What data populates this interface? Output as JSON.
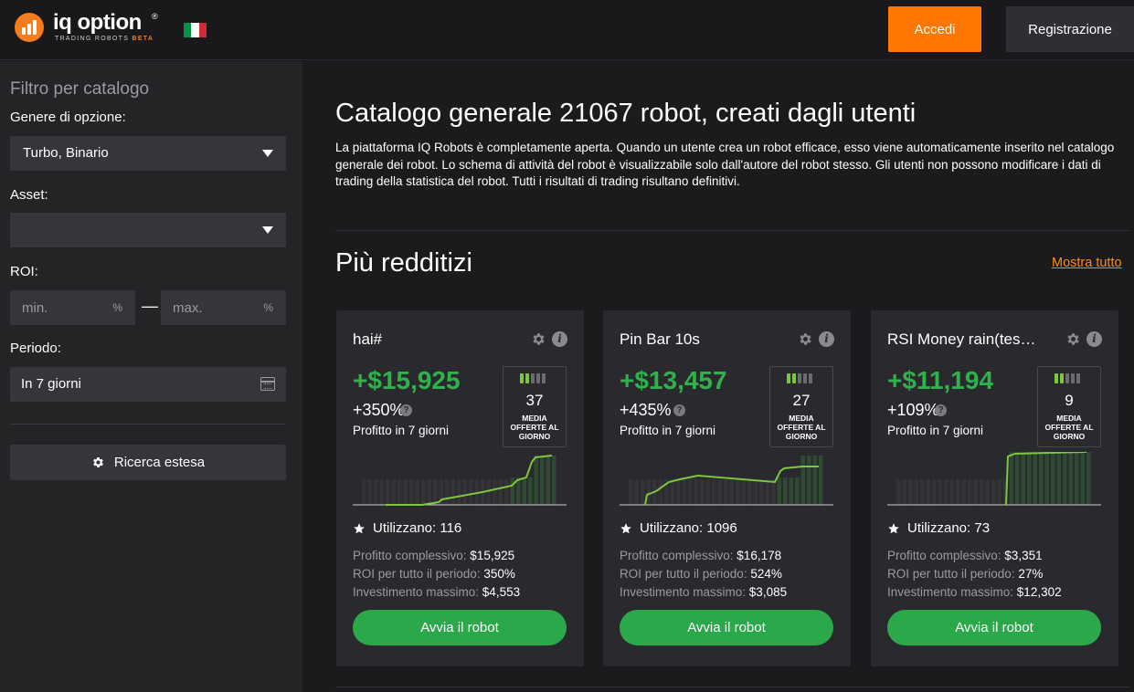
{
  "header": {
    "logo_name": "iq option",
    "logo_reg": "®",
    "logo_sub": "TRADING ROBOTS",
    "logo_beta": "BETA",
    "login_label": "Accedi",
    "register_label": "Registrazione",
    "flag_colors": [
      "#009246",
      "#ffffff",
      "#ce2b37"
    ]
  },
  "sidebar": {
    "title": "Filtro per catalogo",
    "option_type_label": "Genere di opzione:",
    "option_type_value": "Turbo, Binario",
    "asset_label": "Asset:",
    "asset_value": "",
    "roi_label": "ROI:",
    "roi_min_placeholder": "min.",
    "roi_max_placeholder": "max.",
    "roi_unit": "%",
    "roi_dash": "—",
    "period_label": "Periodo:",
    "period_value": "In 7 giorni",
    "search_label": "Ricerca estesa"
  },
  "main": {
    "title": "Catalogo generale 21067 robot, creati dagli utenti",
    "description": "La piattaforma IQ Robots è completamente aperta. Quando un utente crea un robot efficace, esso viene automaticamente inserito nel catalogo generale dei robot. Lo schema di attività del robot è visualizzabile solo dall'autore del robot stesso. Gli utenti non possono modificare i dati di trading della statistica del robot. Tutti i risultati di trading risultano definitivi.",
    "section_title": "Più redditizi",
    "show_all": "Mostra tutto"
  },
  "labels": {
    "profit_period": "Profitto in 7 giorni",
    "trades_caption_1": "MEDIA",
    "trades_caption_2": "OFFERTE AL",
    "trades_caption_3": "GIORNO",
    "users_prefix": "Utilizzano: ",
    "total_profit": "Profitto complessivo: ",
    "roi_period": "ROI per tutto il periodo: ",
    "max_investment": "Investimento massimo: ",
    "start_button": "Avvia il robot",
    "help_mark": "?",
    "info_mark": "i"
  },
  "colors": {
    "accent": "#ff7700",
    "profit_green": "#2fb14c",
    "button_green": "#2aa84a",
    "spark_line": "#7dc640"
  },
  "cards": [
    {
      "name": "hai#",
      "profit": "+$15,925",
      "percent": "+350%",
      "trades": "37",
      "users_count": "116",
      "total_profit": "$15,925",
      "roi": "350%",
      "max_investment": "$4,553"
    },
    {
      "name": "Pin Bar 10s",
      "profit": "+$13,457",
      "percent": "+435%",
      "trades": "27",
      "users_count": "1096",
      "total_profit": "$16,178",
      "roi": "524%",
      "max_investment": "$3,085"
    },
    {
      "name": "RSI Money rain(tes…",
      "profit": "+$11,194",
      "percent": "+109%",
      "trades": "9",
      "users_count": "73",
      "total_profit": "$3,351",
      "roi": "27%",
      "max_investment": "$12,302"
    }
  ]
}
